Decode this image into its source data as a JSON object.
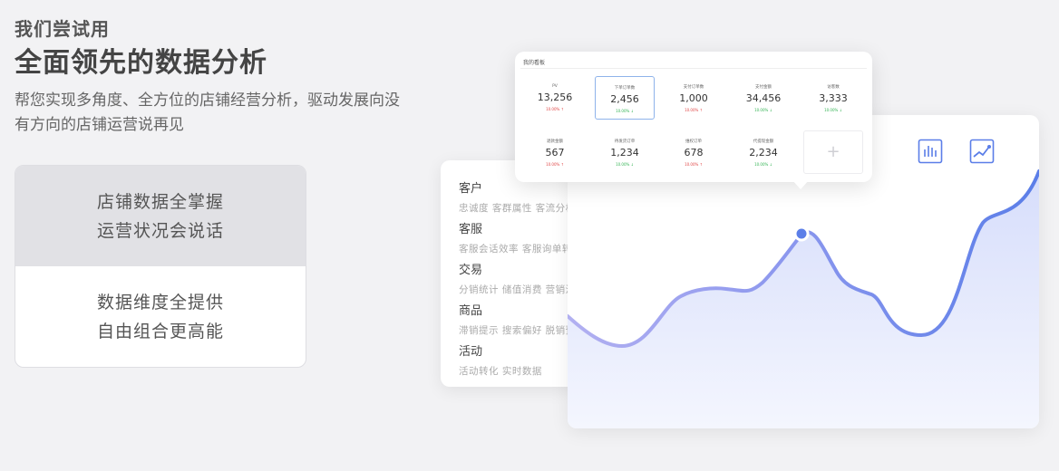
{
  "hero": {
    "eyebrow": "我们尝试用",
    "headline": "全面领先的数据分析",
    "desc": "帮您实现多角度、全方位的店铺经营分析，驱动发展向没有方向的店铺运营说再见"
  },
  "features": [
    {
      "line1": "店铺数据全掌握",
      "line2": "运营状况会说话",
      "active": true
    },
    {
      "line1": "数据维度全提供",
      "line2": "自由组合更高能",
      "active": false
    }
  ],
  "categories": [
    {
      "title": "客户",
      "tags": "忠诚度  客群属性  客流分析"
    },
    {
      "title": "客服",
      "tags": "客服会话效率  客服询单转化"
    },
    {
      "title": "交易",
      "tags": "分销统计  储值消费  营销活动"
    },
    {
      "title": "商品",
      "tags": "滞销提示  搜索偏好  脱销预警"
    },
    {
      "title": "活动",
      "tags": "活动转化  实时数据"
    }
  ],
  "metrics_panel": {
    "title": "我的看板",
    "items": [
      {
        "label": "PV",
        "value": "13,256",
        "change": "10.00% ↑",
        "direction": "up",
        "selected": false
      },
      {
        "label": "下单订单数",
        "value": "2,456",
        "change": "10.00% ↓",
        "direction": "down",
        "selected": true
      },
      {
        "label": "支付订单数",
        "value": "1,000",
        "change": "10.00% ↑",
        "direction": "up",
        "selected": false
      },
      {
        "label": "支付金额",
        "value": "34,456",
        "change": "10.00% ↓",
        "direction": "down",
        "selected": false
      },
      {
        "label": "访客数",
        "value": "3,333",
        "change": "10.00% ↓",
        "direction": "down",
        "selected": false
      },
      {
        "label": "退款金额",
        "value": "567",
        "change": "10.00% ↑",
        "direction": "up",
        "selected": false
      },
      {
        "label": "待发货订单",
        "value": "1,234",
        "change": "10.00% ↓",
        "direction": "down",
        "selected": false
      },
      {
        "label": "维权订单",
        "value": "678",
        "change": "10.00% ↑",
        "direction": "up",
        "selected": false
      },
      {
        "label": "代提现金额",
        "value": "2,234",
        "change": "10.00% ↓",
        "direction": "down",
        "selected": false
      }
    ],
    "add_label": "+"
  },
  "chart_icons": [
    "bar-chart-icon",
    "line-chart-icon"
  ],
  "colors": {
    "accent": "#5b7ee8",
    "up": "#e04646",
    "down": "#35b455"
  }
}
